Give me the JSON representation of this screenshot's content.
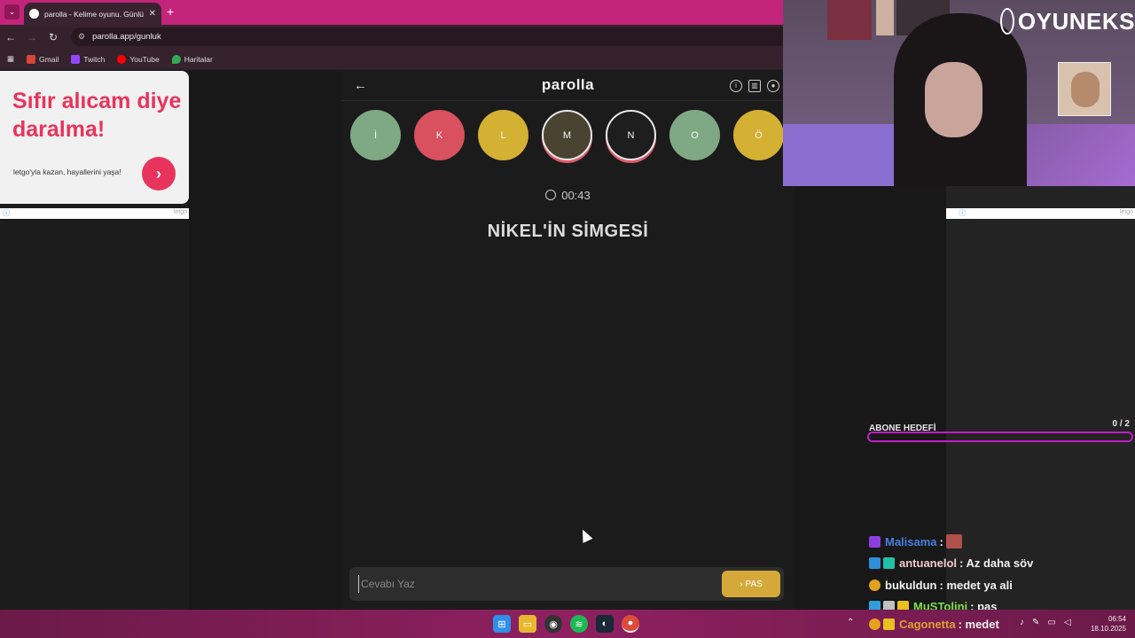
{
  "browser": {
    "tab_title": "parolla - Kelime oyunu. Günlük",
    "url": "parolla.app/gunluk",
    "bookmarks": [
      {
        "label": "Gmail",
        "color": "#d44638"
      },
      {
        "label": "Twitch",
        "color": "#9146ff"
      },
      {
        "label": "YouTube",
        "color": "#ff0000"
      },
      {
        "label": "Haritalar",
        "color": "#34a853"
      }
    ]
  },
  "ad": {
    "headline": "Sıfır alıcam diye daralma!",
    "subtext": "letgo'yla kazan, hayallerini yaşa!",
    "source": "letgo"
  },
  "game": {
    "logo": "parolla",
    "letters": [
      {
        "char": "İ",
        "color": "#7fa884",
        "state": "done"
      },
      {
        "char": "K",
        "color": "#d9505e",
        "state": "wrong"
      },
      {
        "char": "L",
        "color": "#d4b033",
        "state": "passed"
      },
      {
        "char": "M",
        "color": "#4a4332",
        "state": "current"
      },
      {
        "char": "N",
        "color": "#1e1e1e",
        "state": "current"
      },
      {
        "char": "O",
        "color": "#7fa884",
        "state": "done"
      },
      {
        "char": "Ö",
        "color": "#d4b033",
        "state": "passed"
      }
    ],
    "timer": "00:43",
    "question": "NİKEL'İN SİMGESİ",
    "answer_placeholder": "Cevabı Yaz",
    "pass_label": "PAS"
  },
  "stream": {
    "brand": "OYUNEKS",
    "sub_goal": {
      "label": "ABONE HEDEFİ",
      "count": "0 / 2",
      "progress": 0
    },
    "chat": [
      {
        "user": "Malisama",
        "user_color": "#4a7fe0",
        "text": ":",
        "badges": [
          "#8b3fe0"
        ],
        "emote": true
      },
      {
        "user": "antuanelol",
        "user_color": "#f0c8d0",
        "text": ": Az daha söv",
        "badges": [
          "#2f8fd8",
          "#23c0a8"
        ]
      },
      {
        "user": "bukuldun",
        "user_color": "#f0f0f0",
        "text": ": medet ya ali",
        "badges": [
          "#e0a020"
        ]
      },
      {
        "user": "MuSTolini",
        "user_color": "#7ee04a",
        "text": ": pas",
        "badges": [
          "#2f9fe0",
          "#c0c0c0",
          "#e8c020"
        ]
      },
      {
        "user": "Cagonetta",
        "user_color": "#e0a030",
        "text": ": medet",
        "badges": [
          "#e8a020",
          "#e8c020"
        ]
      }
    ]
  },
  "taskbar": {
    "time": "06:54",
    "date": "18.10.2025"
  }
}
